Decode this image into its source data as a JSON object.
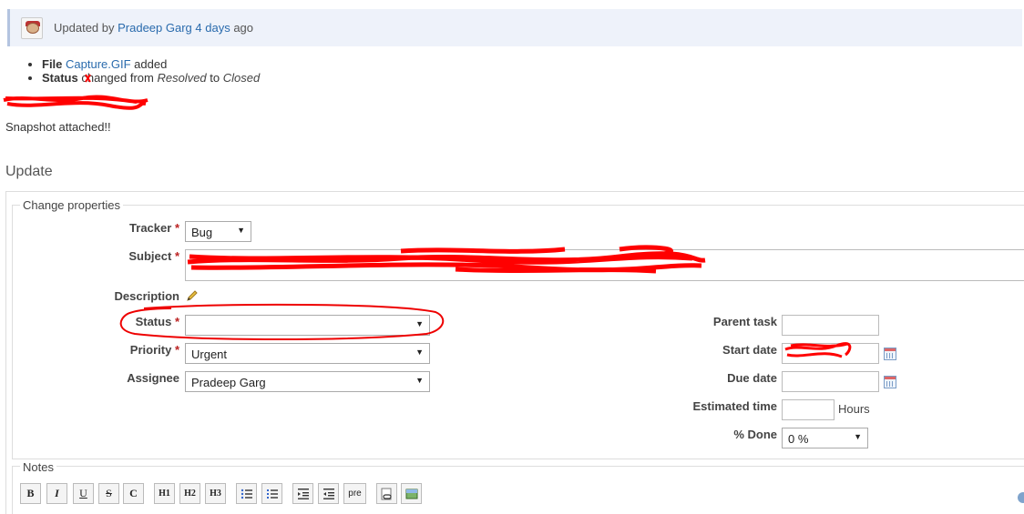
{
  "journal": {
    "prefix": "Updated by ",
    "author": "Pradeep Garg",
    "time": "4 days",
    "suffix": " ago"
  },
  "details": {
    "file_label": "File",
    "file_name": "Capture.GIF",
    "file_action": " added",
    "status_label": "Status",
    "status_text_a": " changed from ",
    "status_from": "Resolved",
    "status_text_b": " to ",
    "status_to": "Closed"
  },
  "snapshot_text": "Snapshot attached!!",
  "update_title": "Update",
  "change_properties": "Change properties",
  "fields": {
    "tracker": {
      "label": "Tracker",
      "value": "Bug"
    },
    "subject": {
      "label": "Subject"
    },
    "description": {
      "label": "Description"
    },
    "status": {
      "label": "Status",
      "value": ""
    },
    "priority": {
      "label": "Priority",
      "value": "Urgent"
    },
    "assignee": {
      "label": "Assignee",
      "value": "Pradeep Garg"
    },
    "parent_task": {
      "label": "Parent task"
    },
    "start_date": {
      "label": "Start date"
    },
    "due_date": {
      "label": "Due date"
    },
    "estimated_time": {
      "label": "Estimated time",
      "unit": "Hours"
    },
    "done": {
      "label": "% Done",
      "value": "0 %"
    }
  },
  "required_mark": "*",
  "notes_label": "Notes",
  "toolbar": [
    "B",
    "I",
    "U",
    "S",
    "C",
    "H1",
    "H2",
    "H3",
    "ul",
    "ol",
    "indent",
    "outdent",
    "pre",
    "link",
    "img"
  ],
  "toolbar_text": {
    "pre": "pre",
    "h1": "H1",
    "h2": "H2",
    "h3": "H3",
    "b": "B",
    "i": "I",
    "u": "U",
    "s": "S",
    "c": "C"
  }
}
